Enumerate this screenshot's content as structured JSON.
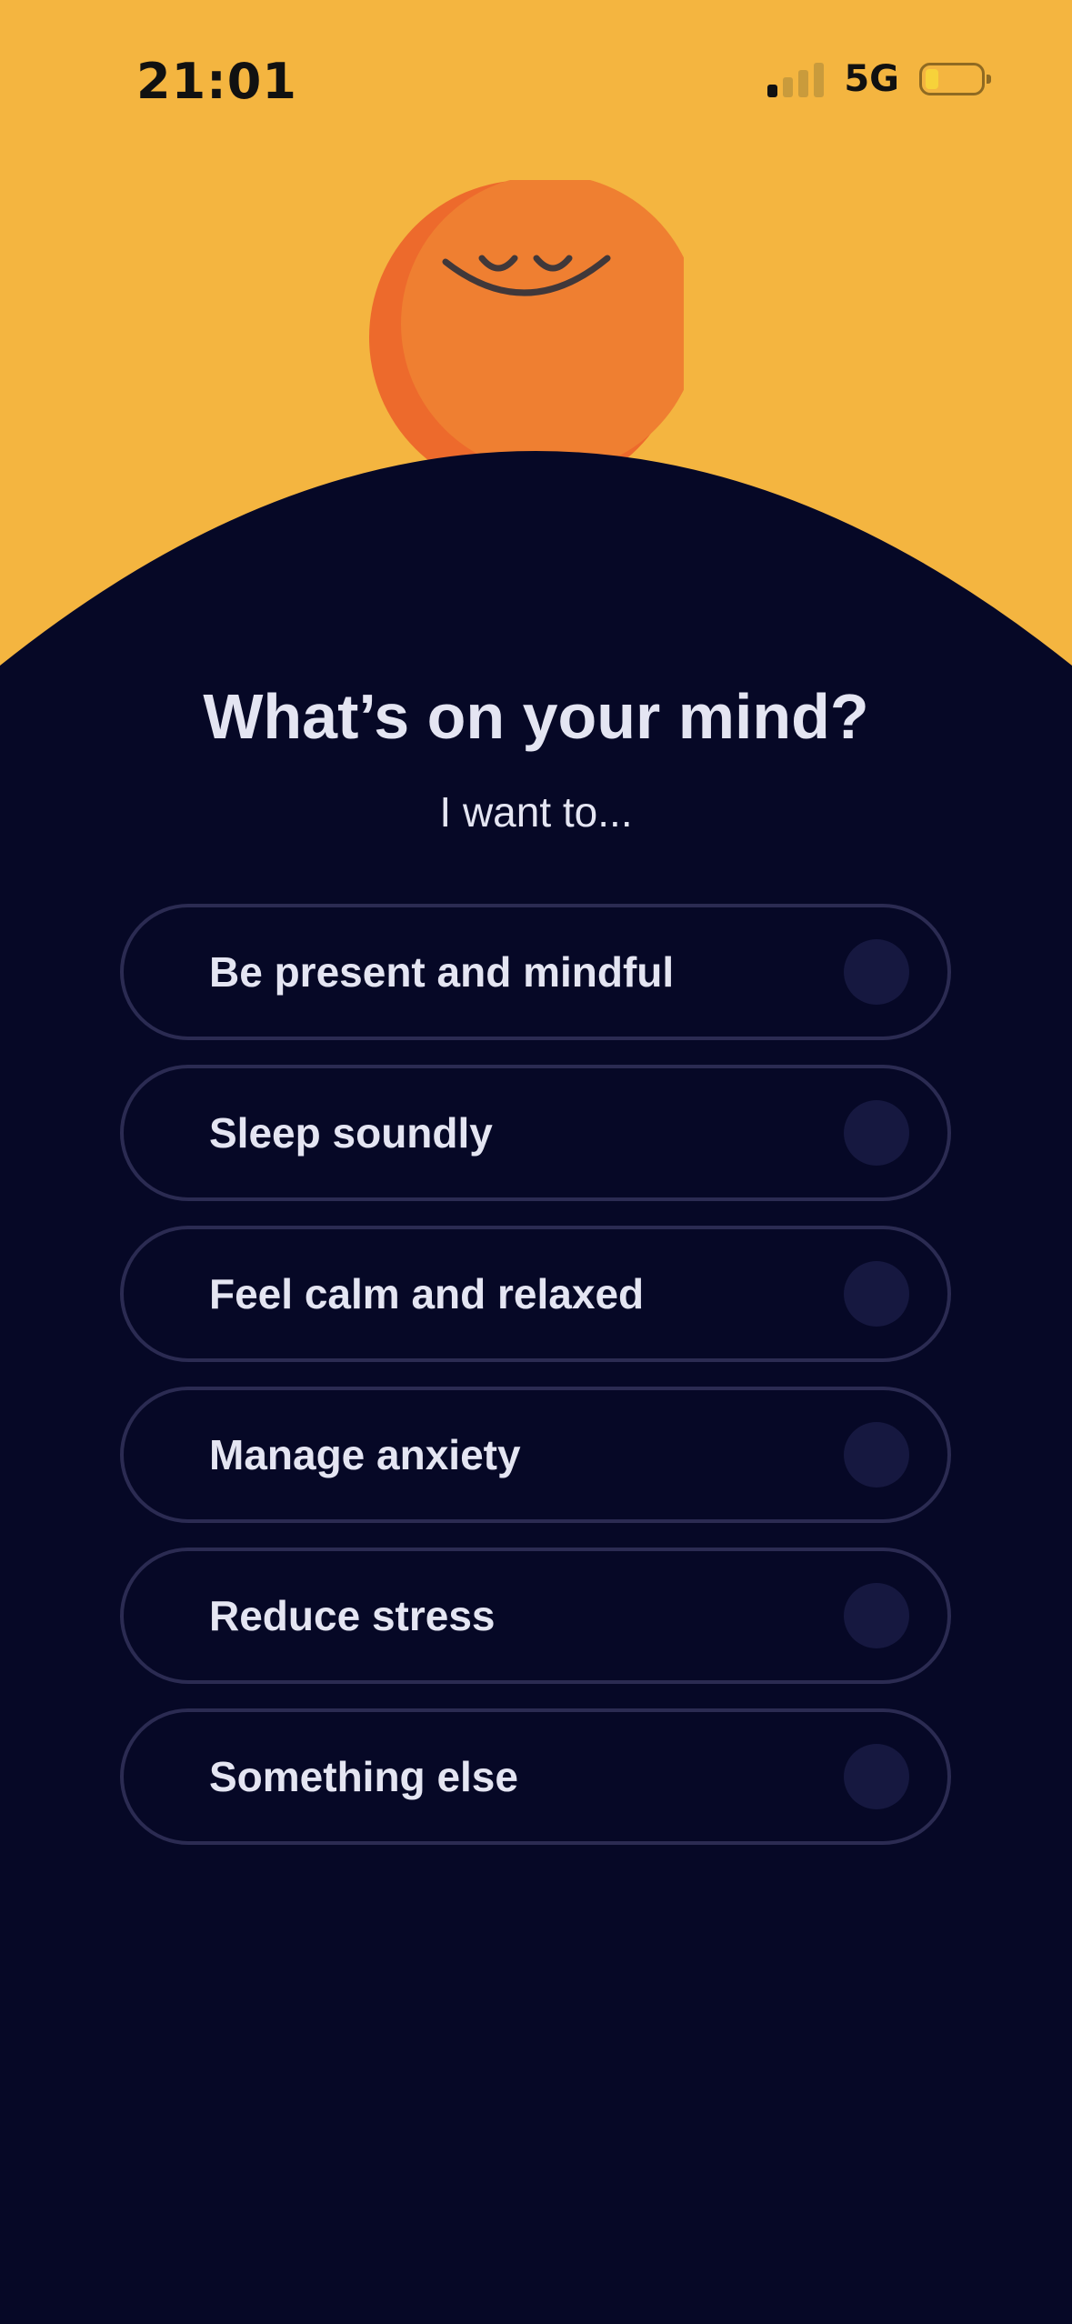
{
  "colors": {
    "hero_background": "#F4B540",
    "panel_background": "#060826",
    "mascot_orange": "#EF7F31",
    "mascot_shadow": "#ED6A2C",
    "option_border": "#2B2B52",
    "radio_fill": "#161840",
    "text_light": "#E4E5F2"
  },
  "status_bar": {
    "time": "21:01",
    "network": "5G",
    "signal_bars_active": 1,
    "signal_bars_total": 4,
    "battery_level": 0.2
  },
  "mascot": {
    "icon": "sleeping-sun-face-icon"
  },
  "question": {
    "title": "What’s on your mind?",
    "subtitle": "I want to..."
  },
  "options": [
    {
      "label": "Be present and mindful",
      "selected": false
    },
    {
      "label": "Sleep soundly",
      "selected": false
    },
    {
      "label": "Feel calm and relaxed",
      "selected": false
    },
    {
      "label": "Manage anxiety",
      "selected": false
    },
    {
      "label": "Reduce stress",
      "selected": false
    },
    {
      "label": "Something else",
      "selected": false
    }
  ]
}
